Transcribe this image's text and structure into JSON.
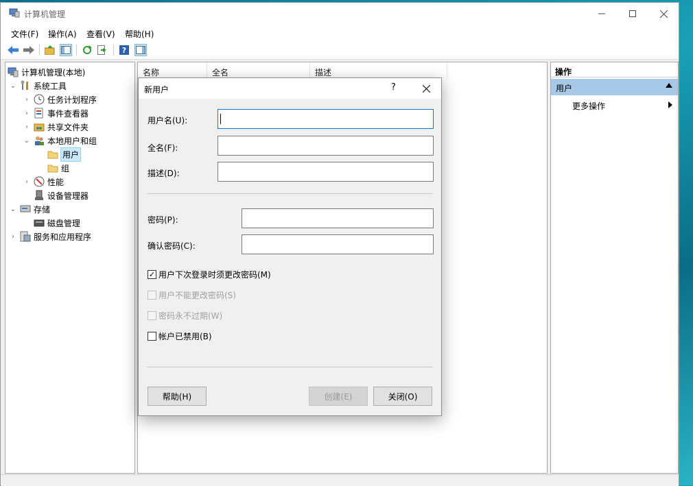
{
  "window": {
    "title": "计算机管理"
  },
  "menu": [
    {
      "label": "文件(F)"
    },
    {
      "label": "操作(A)"
    },
    {
      "label": "查看(V)"
    },
    {
      "label": "帮助(H)"
    }
  ],
  "tree": [
    {
      "label": "计算机管理(本地)",
      "icon": "computer-management-icon"
    },
    {
      "label": "系统工具",
      "icon": "system-tools-icon"
    },
    {
      "label": "任务计划程序",
      "icon": "clock-icon"
    },
    {
      "label": "事件查看器",
      "icon": "event-viewer-icon"
    },
    {
      "label": "共享文件夹",
      "icon": "shared-folder-icon"
    },
    {
      "label": "本地用户和组",
      "icon": "users-icon"
    },
    {
      "label": "用户",
      "icon": "folder-icon"
    },
    {
      "label": "组",
      "icon": "folder-icon"
    },
    {
      "label": "性能",
      "icon": "performance-icon"
    },
    {
      "label": "设备管理器",
      "icon": "device-manager-icon"
    },
    {
      "label": "存储",
      "icon": "storage-icon"
    },
    {
      "label": "磁盘管理",
      "icon": "disk-icon"
    },
    {
      "label": "服务和应用程序",
      "icon": "services-icon"
    }
  ],
  "list": {
    "columns": [
      "名称",
      "全名",
      "描述"
    ]
  },
  "actions": {
    "header": "操作",
    "section": "用户",
    "more": "更多操作"
  },
  "dialog": {
    "title": "新用户",
    "help_glyph": "?",
    "fields": {
      "username_label": "用户名(U):",
      "username_value": "",
      "fullname_label": "全名(F):",
      "fullname_value": "",
      "description_label": "描述(D):",
      "description_value": "",
      "password_label": "密码(P):",
      "password_value": "",
      "confirm_label": "确认密码(C):",
      "confirm_value": ""
    },
    "checkboxes": [
      {
        "label": "用户下次登录时须更改密码(M)",
        "checked": true,
        "enabled": true
      },
      {
        "label": "用户不能更改密码(S)",
        "checked": false,
        "enabled": false
      },
      {
        "label": "密码永不过期(W)",
        "checked": false,
        "enabled": false
      },
      {
        "label": "帐户已禁用(B)",
        "checked": false,
        "enabled": true
      }
    ],
    "buttons": {
      "help": "帮助(H)",
      "create": "创建(E)",
      "close": "关闭(O)"
    }
  }
}
